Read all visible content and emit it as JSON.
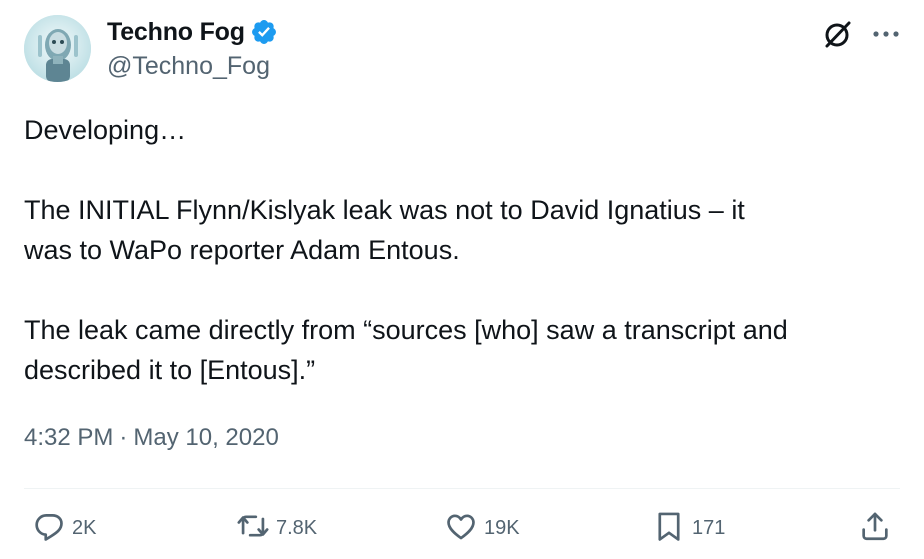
{
  "author": {
    "display_name": "Techno Fog",
    "handle": "@Techno_Fog",
    "verified": true
  },
  "tweet": {
    "paragraphs": [
      "Developing…",
      "The INITIAL Flynn/Kislyak leak was not to David Ignatius – it\nwas to WaPo reporter Adam Entous.",
      "The leak came directly from “sources [who] saw a transcript and\ndescribed it to [Entous].”"
    ],
    "time": "4:32 PM",
    "separator": "·",
    "date": "May 10, 2020"
  },
  "actions": {
    "replies": "2K",
    "reposts": "7.8K",
    "likes": "19K",
    "bookmarks": "171"
  },
  "colors": {
    "text": "#0f1419",
    "secondary": "#536471",
    "verified": "#1d9bf0"
  },
  "icons": {
    "verified": "verified-badge-icon",
    "grok": "grok-icon",
    "more": "more-dots-icon",
    "reply": "reply-icon",
    "repost": "repost-icon",
    "like": "heart-icon",
    "bookmark": "bookmark-icon",
    "share": "share-icon"
  }
}
